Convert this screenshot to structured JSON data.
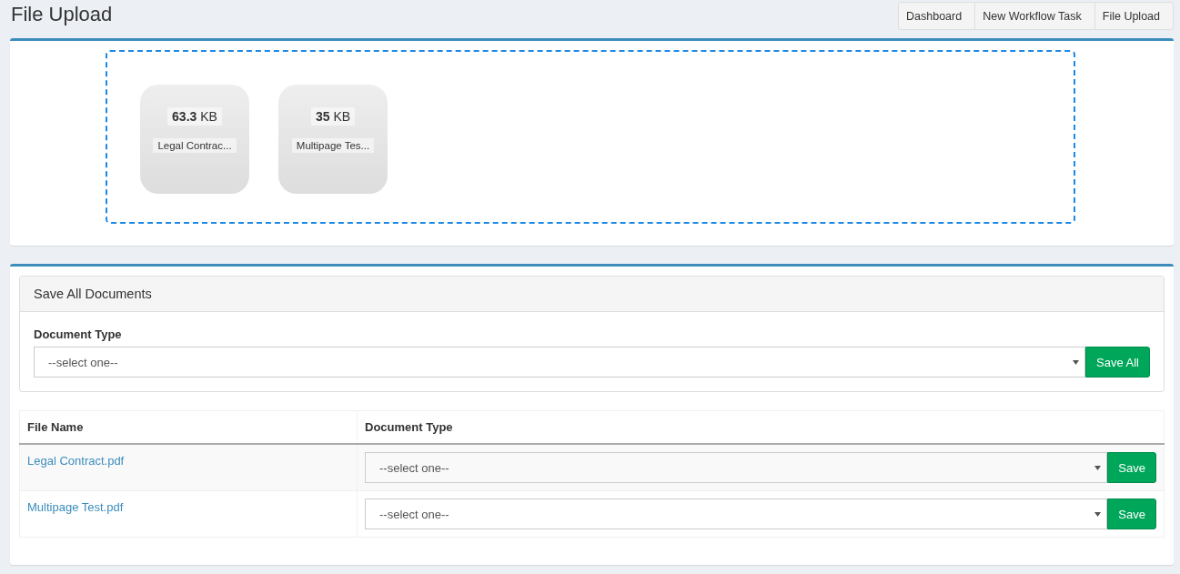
{
  "page_title": "File Upload",
  "breadcrumb": [
    "Dashboard",
    "New Workflow Task",
    "File Upload"
  ],
  "uploads": [
    {
      "size": "**63.3** KB",
      "name": "Legal Contrac..."
    },
    {
      "size": "**35** KB",
      "name": "Multipage Tes..."
    }
  ],
  "save_all_panel": {
    "heading": "Save All Documents",
    "label": "Document Type",
    "select": "--select one--",
    "button": "Save All"
  },
  "table": {
    "columns": [
      "File Name",
      "Document Type"
    ],
    "rows": [
      {
        "file": "Legal Contract.pdf",
        "select": "--select one--",
        "button": "Save"
      },
      {
        "file": "Multipage Test.pdf",
        "select": "--select one--",
        "button": "Save"
      }
    ]
  }
}
